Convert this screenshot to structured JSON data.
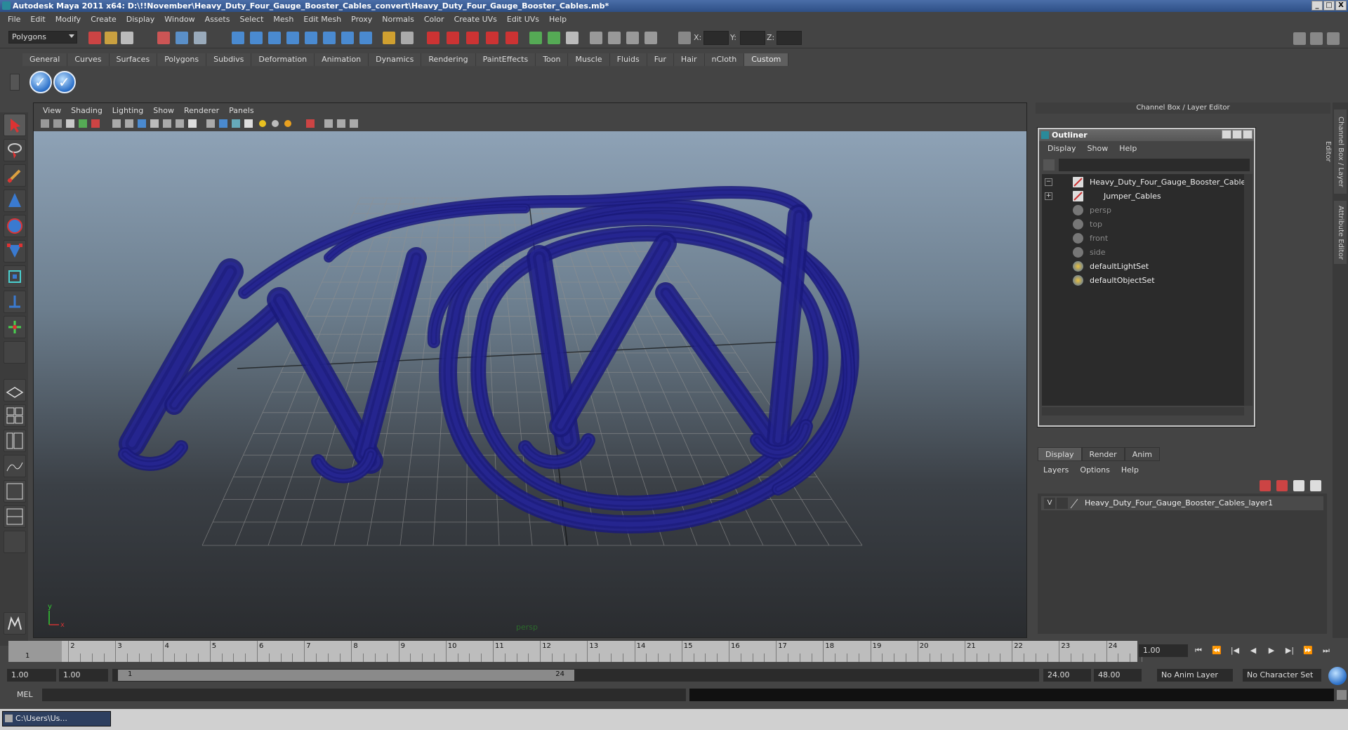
{
  "window": {
    "title": "Autodesk Maya 2011 x64: D:\\!!November\\Heavy_Duty_Four_Gauge_Booster_Cables_convert\\Heavy_Duty_Four_Gauge_Booster_Cables.mb*",
    "min": "_",
    "max": "□",
    "close": "X"
  },
  "menubar": [
    "File",
    "Edit",
    "Modify",
    "Create",
    "Display",
    "Window",
    "Assets",
    "Select",
    "Mesh",
    "Edit Mesh",
    "Proxy",
    "Normals",
    "Color",
    "Create UVs",
    "Edit UVs",
    "Help"
  ],
  "statusline": {
    "mode": "Polygons",
    "x_label": "X:",
    "y_label": "Y:",
    "z_label": "Z:"
  },
  "shelf": {
    "tabs": [
      "General",
      "Curves",
      "Surfaces",
      "Polygons",
      "Subdivs",
      "Deformation",
      "Animation",
      "Dynamics",
      "Rendering",
      "PaintEffects",
      "Toon",
      "Muscle",
      "Fluids",
      "Fur",
      "Hair",
      "nCloth",
      "Custom"
    ],
    "active": "Custom",
    "button_glyph": "✓"
  },
  "viewport": {
    "menu": [
      "View",
      "Shading",
      "Lighting",
      "Show",
      "Renderer",
      "Panels"
    ],
    "camera_label": "persp",
    "axis_x": "x",
    "axis_y": "y"
  },
  "channelbox": {
    "title": "Channel Box / Layer Editor"
  },
  "side_tabs": {
    "channel": "Channel Box / Layer Editor",
    "attribute": "Attribute Editor"
  },
  "outliner": {
    "title": "Outliner",
    "menu": [
      "Display",
      "Show",
      "Help"
    ],
    "items": [
      {
        "label": "Heavy_Duty_Four_Gauge_Booster_Cables",
        "expand": "−",
        "kind": "mesh"
      },
      {
        "label": "Jumper_Cables",
        "expand": "+",
        "kind": "mesh"
      },
      {
        "label": "persp",
        "kind": "camera"
      },
      {
        "label": "top",
        "kind": "camera"
      },
      {
        "label": "front",
        "kind": "camera"
      },
      {
        "label": "side",
        "kind": "camera"
      },
      {
        "label": "defaultLightSet",
        "kind": "set"
      },
      {
        "label": "defaultObjectSet",
        "kind": "set"
      }
    ]
  },
  "layereditor": {
    "tabs": [
      "Display",
      "Render",
      "Anim"
    ],
    "active": "Display",
    "menu": [
      "Layers",
      "Options",
      "Help"
    ],
    "layer": {
      "visible": "V",
      "name": "Heavy_Duty_Four_Gauge_Booster_Cables_layer1"
    }
  },
  "timeslider": {
    "ticks": [
      "1",
      "2",
      "3",
      "4",
      "5",
      "6",
      "7",
      "8",
      "9",
      "10",
      "11",
      "12",
      "13",
      "14",
      "15",
      "16",
      "17",
      "18",
      "19",
      "20",
      "21",
      "22",
      "23",
      "24"
    ],
    "current_marker": "1",
    "current_frame": "1.00"
  },
  "playback": [
    "⏮",
    "⏪",
    "|◀",
    "◀",
    "▶",
    "▶|",
    "⏩",
    "⏭"
  ],
  "range": {
    "start": "1.00",
    "start_inner": "1.00",
    "handle_start": "1",
    "handle_end": "24",
    "end_inner": "24.00",
    "end": "48.00",
    "anim_layer": "No Anim Layer",
    "character_set": "No Character Set"
  },
  "mel": {
    "label": "MEL"
  },
  "taskbar": {
    "item": "C:\\Users\\Us..."
  },
  "colors": {
    "wire": "#1a1a7a",
    "grid": "#909090",
    "accent": "#4a6ea8"
  }
}
